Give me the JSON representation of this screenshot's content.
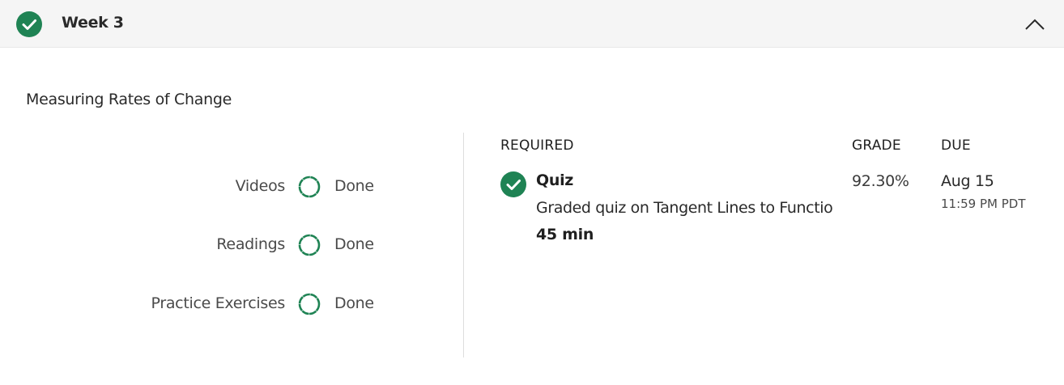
{
  "colors": {
    "accent_green": "#1f8354",
    "header_bg": "#f5f5f5"
  },
  "week": {
    "title": "Week 3",
    "status_icon": "check-circle-icon",
    "toggle_icon": "chevron-up-icon",
    "completed": true,
    "expanded": true
  },
  "lesson": {
    "title": "Measuring Rates of Change",
    "progress": [
      {
        "label": "Videos",
        "status": "Done",
        "icon": "progress-ring-icon"
      },
      {
        "label": "Readings",
        "status": "Done",
        "icon": "progress-ring-icon"
      },
      {
        "label": "Practice Exercises",
        "status": "Done",
        "icon": "progress-ring-icon"
      }
    ]
  },
  "items_table": {
    "headers": {
      "required": "REQUIRED",
      "grade": "GRADE",
      "due": "DUE"
    },
    "rows": [
      {
        "type": "Quiz",
        "description": "Graded quiz on Tangent Lines to Functions",
        "duration": "45 min",
        "grade": "92.30%",
        "due_date": "Aug 15",
        "due_time": "11:59 PM PDT",
        "completed": true,
        "status_icon": "check-circle-icon"
      }
    ]
  }
}
